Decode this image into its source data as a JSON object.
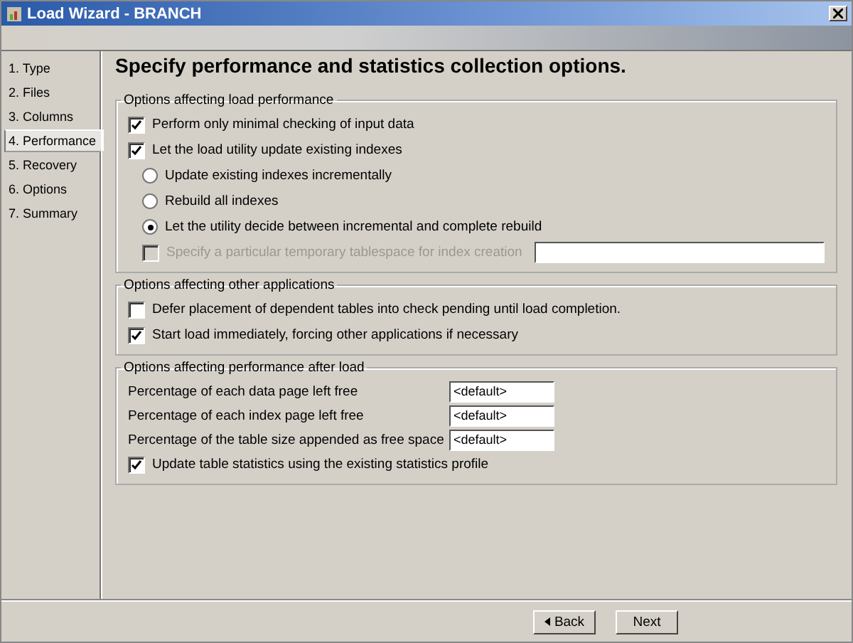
{
  "window": {
    "title": "Load Wizard - BRANCH"
  },
  "steps": [
    {
      "label": "1. Type",
      "selected": false
    },
    {
      "label": "2. Files",
      "selected": false
    },
    {
      "label": "3. Columns",
      "selected": false
    },
    {
      "label": "4. Performance",
      "selected": true
    },
    {
      "label": "5. Recovery",
      "selected": false
    },
    {
      "label": "6. Options",
      "selected": false
    },
    {
      "label": "7. Summary",
      "selected": false
    }
  ],
  "heading": "Specify performance and statistics collection options.",
  "groups": [
    {
      "title": "Options affecting load performance",
      "options": [
        {
          "kind": "checkbox",
          "label": "Perform only minimal checking of input data",
          "checked": true,
          "disabled": false
        },
        {
          "kind": "checkbox",
          "label": "Let the load utility update existing indexes",
          "checked": true,
          "disabled": false,
          "children": [
            {
              "kind": "radio",
              "label": "Update existing indexes incrementally",
              "selected": false
            },
            {
              "kind": "radio",
              "label": "Rebuild all indexes",
              "selected": false
            },
            {
              "kind": "radio",
              "label": "Let the utility decide between incremental and complete rebuild",
              "selected": true
            },
            {
              "kind": "checkbox-field",
              "label": "Specify a particular temporary tablespace for index creation",
              "checked": false,
              "disabled": true
            }
          ]
        }
      ]
    },
    {
      "title": "Options affecting other applications",
      "options": [
        {
          "kind": "checkbox",
          "label": "Defer placement of dependent tables into check pending until load completion.",
          "checked": false,
          "disabled": false
        },
        {
          "kind": "checkbox",
          "label": "Start load immediately, forcing other applications if necessary",
          "checked": true,
          "disabled": false
        }
      ]
    },
    {
      "title": "Options affecting performance after load",
      "options": [
        {
          "kind": "field",
          "label": "Percentage of each data page left free",
          "value": "<default>"
        },
        {
          "kind": "field",
          "label": "Percentage of each index page left free",
          "value": "<default>"
        },
        {
          "kind": "field",
          "label": "Percentage of the table size appended as free space",
          "value": "<default>"
        },
        {
          "kind": "checkbox",
          "label": "Update table statistics using the existing statistics profile",
          "checked": true,
          "disabled": false
        }
      ]
    }
  ],
  "buttons": [
    {
      "kind": "back",
      "label": "Back"
    },
    {
      "kind": "next",
      "label": "Next"
    }
  ]
}
